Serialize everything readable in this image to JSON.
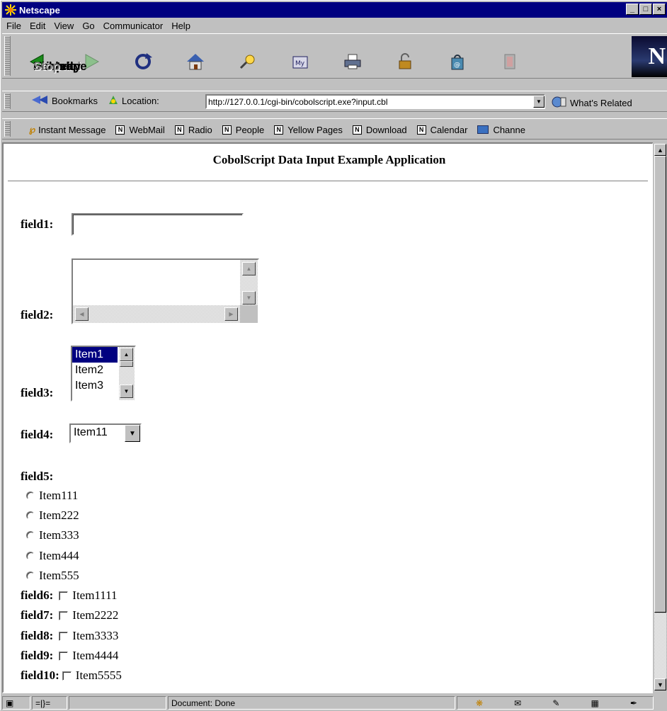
{
  "window": {
    "title": "Netscape"
  },
  "menu": [
    "File",
    "Edit",
    "View",
    "Go",
    "Communicator",
    "Help"
  ],
  "nav": {
    "back": "Back",
    "forward": "Forward",
    "reload": "Reload",
    "home": "Home",
    "search": "Search",
    "netscape": "Netscape",
    "print": "Print",
    "security": "Security",
    "shop": "Shop",
    "stop": "Stop"
  },
  "location": {
    "bookmarks": "Bookmarks",
    "label": "Location:",
    "url": "http://127.0.0.1/cgi-bin/cobolscript.exe?input.cbl",
    "related": "What's Related"
  },
  "personal": {
    "instant_message": "Instant Message",
    "webmail": "WebMail",
    "radio": "Radio",
    "people": "People",
    "yellow_pages": "Yellow Pages",
    "download": "Download",
    "calendar": "Calendar",
    "channels": "Channe"
  },
  "page": {
    "title": "CobolScript Data Input Example Application",
    "field1": {
      "label": "field1",
      "value": ""
    },
    "field2": {
      "label": "field2",
      "value": ""
    },
    "field3": {
      "label": "field3",
      "options": [
        "Item1",
        "Item2",
        "Item3"
      ],
      "selected": "Item1"
    },
    "field4": {
      "label": "field4",
      "value": "Item11"
    },
    "field5": {
      "label": "field5",
      "options": [
        "Item111",
        "Item222",
        "Item333",
        "Item444",
        "Item555"
      ]
    },
    "field6": {
      "label": "field6",
      "option": "Item1111"
    },
    "field7": {
      "label": "field7",
      "option": "Item2222"
    },
    "field8": {
      "label": "field8",
      "option": "Item3333"
    },
    "field9": {
      "label": "field9",
      "option": "Item4444"
    },
    "field10": {
      "label": "field10",
      "option": "Item5555"
    }
  },
  "status": {
    "text": "Document: Done"
  }
}
